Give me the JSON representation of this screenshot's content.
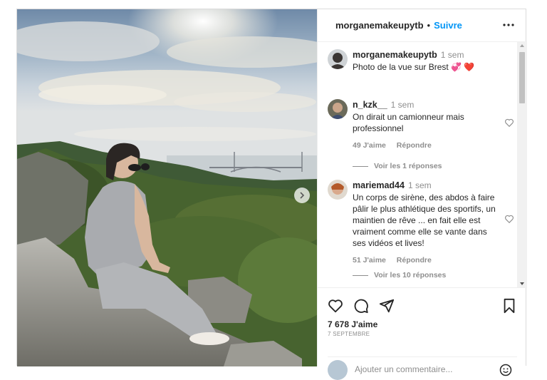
{
  "post": {
    "author": "morganemakeupytb",
    "follow_label": "Suivre",
    "separator": "•",
    "caption": {
      "author": "morganemakeupytb",
      "time": "1 sem",
      "text": "Photo de la vue sur Brest 💞 ❤️"
    },
    "comments": [
      {
        "user": "n_kzk__",
        "time": "1 sem",
        "text": "On dirait un camionneur mais professionnel",
        "likes": "49 J'aime",
        "reply_label": "Répondre",
        "view_replies": "Voir les 1 réponses"
      },
      {
        "user": "mariemad44",
        "time": "1 sem",
        "text": "Un corps de sirène, des abdos à faire pâlir le plus athlétique des sportifs, un maintien de rêve ... en fait elle est vraiment comme elle se vante dans ses vidéos et lives!",
        "likes": "51 J'aime",
        "reply_label": "Répondre",
        "view_replies": "Voir les 10 réponses"
      }
    ],
    "like_count": "7 678 J'aime",
    "date": "7 SEPTEMBRE",
    "add_comment_placeholder": "Ajouter un commentaire..."
  },
  "icons": {
    "more": "more-horizontal-icon",
    "like": "heart-icon",
    "comment": "comment-icon",
    "share": "send-icon",
    "save": "bookmark-icon",
    "next": "chevron-right-icon",
    "emoji": "emoji-icon"
  },
  "colors": {
    "link": "#0095f6",
    "secondary_text": "#8e8e8e",
    "border": "#dbdbdb"
  }
}
